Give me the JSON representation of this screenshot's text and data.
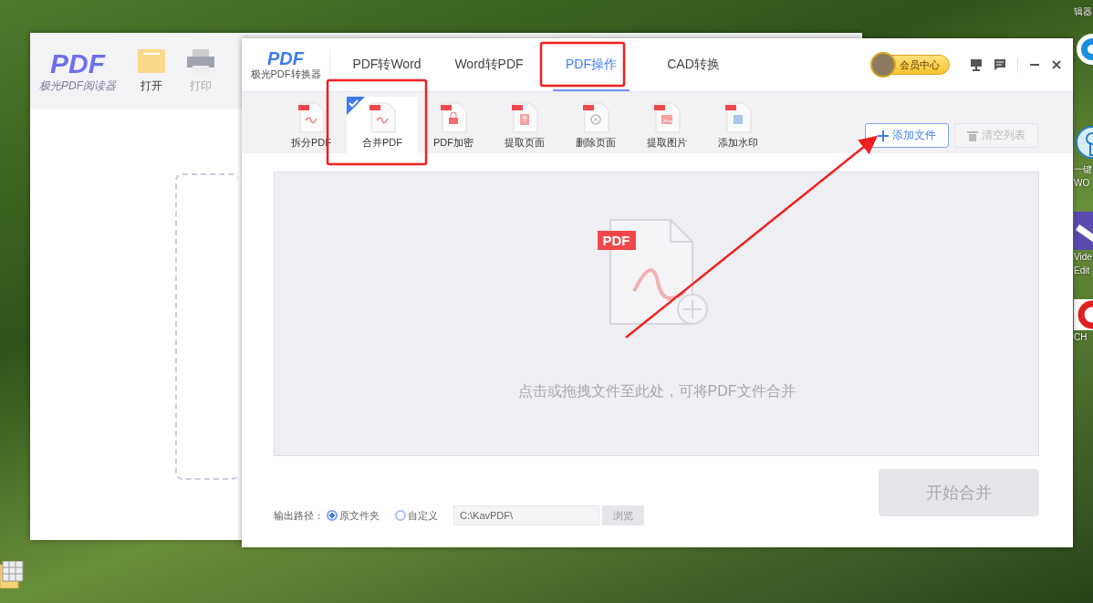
{
  "desktop_icons": [
    {
      "kind": "label",
      "lines": [
        "辑器"
      ]
    },
    {
      "kind": "lens"
    },
    {
      "kind": "gear",
      "lines": [
        "一键",
        "WO"
      ]
    },
    {
      "kind": "video",
      "lines": [
        "Vide",
        "Edit"
      ]
    },
    {
      "kind": "letter",
      "lines": [
        "CH"
      ]
    }
  ],
  "reader_window": {
    "logo": "PDF",
    "app_name": "极光PDF阅读器",
    "tools": [
      {
        "label": "打开",
        "disabled": false
      },
      {
        "label": "打印",
        "disabled": true
      }
    ]
  },
  "converter_window": {
    "logo": "PDF",
    "app_name": "极光PDF转换器",
    "tabs": [
      {
        "label": "PDF转Word",
        "selected": false
      },
      {
        "label": "Word转PDF",
        "selected": false
      },
      {
        "label": "PDF操作",
        "selected": true
      },
      {
        "label": "CAD转换",
        "selected": false
      }
    ],
    "member_button": "会员中心",
    "tools": [
      {
        "label": "拆分PDF",
        "selected": false
      },
      {
        "label": "合并PDF",
        "selected": true
      },
      {
        "label": "PDF加密",
        "selected": false
      },
      {
        "label": "提取页面",
        "selected": false
      },
      {
        "label": "删除页面",
        "selected": false
      },
      {
        "label": "提取图片",
        "selected": false
      },
      {
        "label": "添加水印",
        "selected": false
      }
    ],
    "add_button": {
      "label": "添加文件",
      "disabled": false
    },
    "clear_button": {
      "label": "清空列表",
      "disabled": true
    },
    "drop_zone": {
      "badge": "PDF",
      "hint": "点击或拖拽文件至此处，可将PDF文件合并"
    },
    "start_button": {
      "label": "开始合并",
      "disabled": true
    },
    "output": {
      "label": "输出路径：",
      "options": [
        {
          "label": "原文件夹",
          "selected": true
        },
        {
          "label": "自定义",
          "selected": false
        }
      ],
      "path": "C:\\KavPDF\\",
      "browse_button": {
        "label": "浏览",
        "disabled": true
      }
    }
  }
}
